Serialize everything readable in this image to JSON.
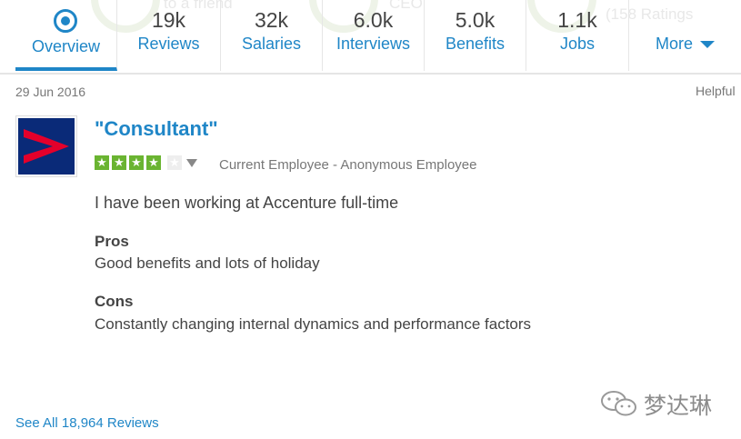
{
  "tabs": [
    {
      "label": "Overview"
    },
    {
      "count": "19k",
      "label": "Reviews"
    },
    {
      "count": "32k",
      "label": "Salaries"
    },
    {
      "count": "6.0k",
      "label": "Interviews"
    },
    {
      "count": "5.0k",
      "label": "Benefits"
    },
    {
      "count": "1.1k",
      "label": "Jobs"
    },
    {
      "label": "More"
    }
  ],
  "background_hints": [
    "to a friend",
    "CEO",
    "(158 Ratings"
  ],
  "review": {
    "date": "29 Jun 2016",
    "helpful": "Helpful",
    "title": "\"Consultant\"",
    "rating": 4,
    "rating_max": 5,
    "author": "Current Employee - Anonymous Employee",
    "summary": "I have been working at Accenture full-time",
    "pros_heading": "Pros",
    "pros_text": "Good benefits and lots of holiday",
    "cons_heading": "Cons",
    "cons_text": "Constantly changing internal dynamics and performance factors"
  },
  "footer": {
    "see_all": "See All 18,964 Reviews"
  },
  "watermark": {
    "text": "梦达琳"
  },
  "colors": {
    "link": "#1f86c7",
    "star_on": "#6ab431",
    "star_off": "#eeeeee",
    "logo_bg": "#0a2a78",
    "logo_mark": "#e4002b"
  }
}
